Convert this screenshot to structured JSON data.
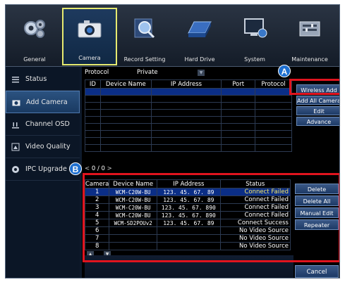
{
  "menu": [
    {
      "label": "General",
      "icon": "gears-icon"
    },
    {
      "label": "Camera",
      "icon": "camera-icon",
      "active": true
    },
    {
      "label": "Record Setting",
      "icon": "magnifier-icon"
    },
    {
      "label": "Hard Drive",
      "icon": "hard-drive-icon"
    },
    {
      "label": "System",
      "icon": "monitor-icon"
    },
    {
      "label": "Maintenance",
      "icon": "toolbox-icon"
    }
  ],
  "sidebar": {
    "items": [
      {
        "label": "Status",
        "icon": "list-icon"
      },
      {
        "label": "Add Camera",
        "icon": "camera-small-icon",
        "active": true
      },
      {
        "label": "Channel OSD",
        "icon": "osd-icon"
      },
      {
        "label": "Video Quality",
        "icon": "video-quality-icon"
      },
      {
        "label": "IPC Upgrade",
        "icon": "upgrade-icon"
      }
    ]
  },
  "protocol": {
    "label": "Protocol",
    "value": "Private"
  },
  "search_table": {
    "headers": [
      "ID",
      "Device Name",
      "IP Address",
      "Port",
      "Protocol"
    ],
    "rows": 9
  },
  "pager": {
    "prev": "<",
    "current": "0",
    "sep": "/",
    "total": "0",
    "next": ">"
  },
  "right_buttons": {
    "wireless_add": "Wireless Add",
    "add_all": "Add All Cameras",
    "edit": "Edit",
    "advance": "Advance"
  },
  "added_table": {
    "headers": [
      "Camera",
      "Device Name",
      "IP Address",
      "Status"
    ],
    "rows": [
      {
        "camera": "1",
        "name": "WCM-C20W-BU",
        "ip": "123. 45. 67. 89",
        "status": "Connect Failed"
      },
      {
        "camera": "2",
        "name": "WCM-C20W-BU",
        "ip": "123. 45. 67. 89",
        "status": "Connect Failed"
      },
      {
        "camera": "3",
        "name": "WCM-C20W-BU",
        "ip": "123. 45. 67. 890",
        "status": "Connect Failed"
      },
      {
        "camera": "4",
        "name": "WCM-C20W-BU",
        "ip": "123. 45. 67. 890",
        "status": "Connect Failed"
      },
      {
        "camera": "5",
        "name": "WCM-SD2POUv2",
        "ip": "123. 45. 67. 89",
        "status": "Connect Success"
      },
      {
        "camera": "6",
        "name": "",
        "ip": "",
        "status": "No Video Source"
      },
      {
        "camera": "7",
        "name": "",
        "ip": "",
        "status": "No Video Source"
      },
      {
        "camera": "8",
        "name": "",
        "ip": "",
        "status": "No Video Source"
      }
    ]
  },
  "bottom_buttons": {
    "delete": "Delete",
    "delete_all": "Delete All",
    "manual_edit": "Manual Edit",
    "repeater": "Repeater"
  },
  "cancel": "Cancel",
  "markers": {
    "a": "A",
    "b": "B"
  },
  "colors": {
    "highlight": "#e0141e",
    "marker": "#1e6fd0",
    "selected_row": "#0b2e86"
  }
}
